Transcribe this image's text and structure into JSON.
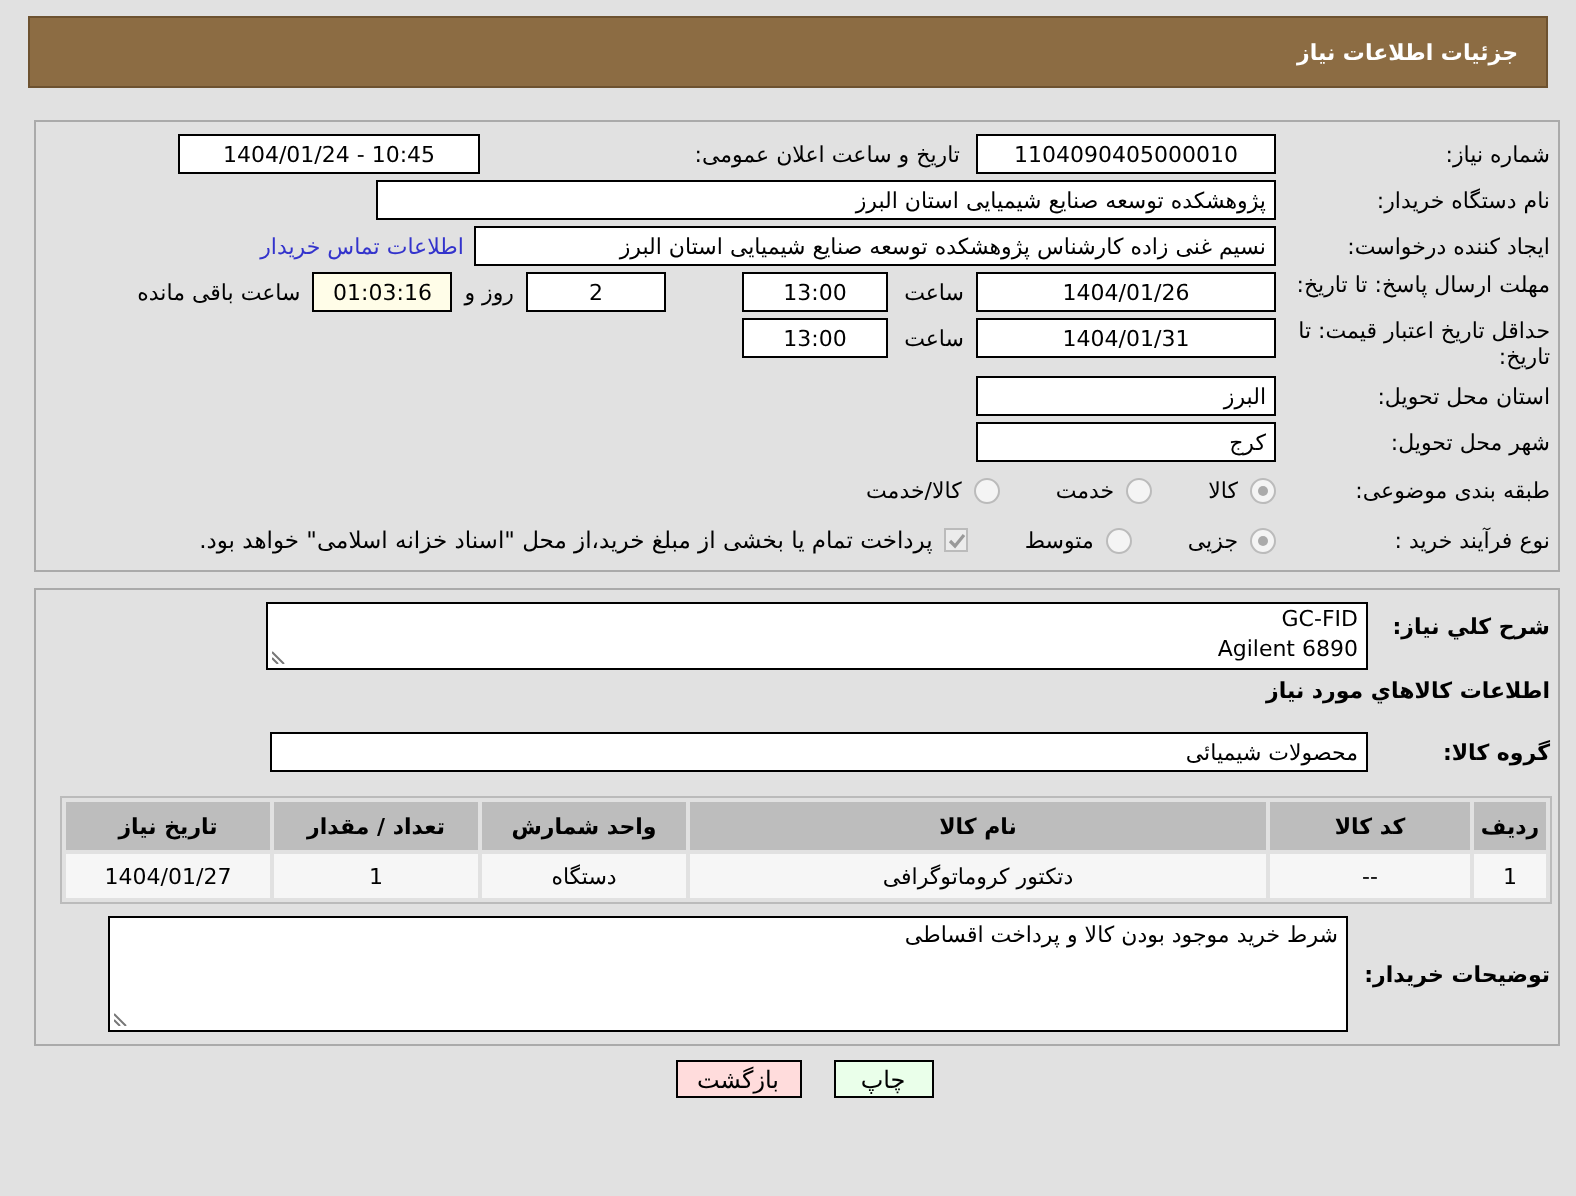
{
  "header": {
    "title": "جزئیات اطلاعات نیاز"
  },
  "need_number": {
    "label": "شماره نیاز:",
    "value": "1104090405000010"
  },
  "announce": {
    "label": "تاریخ و ساعت اعلان عمومی:",
    "value": "1404/01/24 - 10:45"
  },
  "buyer_org": {
    "label": "نام دستگاه خریدار:",
    "value": "پژوهشکده توسعه صنایع شیمیایی استان البرز"
  },
  "requester": {
    "label": "ایجاد کننده درخواست:",
    "value": "نسیم غنی زاده کارشناس پژوهشکده توسعه صنایع شیمیایی استان البرز",
    "link": "اطلاعات تماس خریدار"
  },
  "reply_deadline": {
    "label": "مهلت ارسال پاسخ: تا تاریخ:",
    "date": "1404/01/26",
    "time_label": "ساعت",
    "time": "13:00",
    "days": "2",
    "days_label": "روز و",
    "remaining": "01:03:16",
    "remaining_label": "ساعت باقی مانده"
  },
  "price_validity": {
    "label": "حداقل تاریخ اعتبار قیمت: تا تاریخ:",
    "date": "1404/01/31",
    "time_label": "ساعت",
    "time": "13:00"
  },
  "province": {
    "label": "استان محل تحویل:",
    "value": "البرز"
  },
  "city": {
    "label": "شهر محل تحویل:",
    "value": "کرج"
  },
  "category": {
    "label": "طبقه بندی موضوعی:",
    "options": [
      {
        "label": "کالا",
        "selected": true
      },
      {
        "label": "خدمت",
        "selected": false
      },
      {
        "label": "کالا/خدمت",
        "selected": false
      }
    ]
  },
  "process": {
    "label": "نوع فرآیند خرید :",
    "options": [
      {
        "label": "جزیی",
        "selected": true
      },
      {
        "label": "متوسط",
        "selected": false
      }
    ],
    "payment": {
      "label": "پرداخت تمام یا بخشی از مبلغ خرید،از محل \"اسناد خزانه اسلامی\" خواهد بود.",
      "checked": true
    }
  },
  "description": {
    "label": "شرح کلي نياز:",
    "lines": [
      "GC-FID",
      "Agilent 6890"
    ]
  },
  "goods_heading": "اطلاعات کالاهاي مورد نياز",
  "goods_group": {
    "label": "گروه کالا:",
    "value": "محصولات شیمیائی"
  },
  "table": {
    "columns": [
      "ردیف",
      "کد کالا",
      "نام کالا",
      "واحد شمارش",
      "تعداد / مقدار",
      "تاریخ نیاز"
    ],
    "rows": [
      [
        "1",
        "--",
        "دتکتور کروماتوگرافی",
        "دستگاه",
        "1",
        "1404/01/27"
      ]
    ]
  },
  "notes": {
    "label": "توضیحات خریدار:",
    "value": "شرط خرید موجود بودن کالا و پرداخت اقساطی"
  },
  "buttons": [
    {
      "label": "چاپ",
      "kind": "print"
    },
    {
      "label": "بازگشت",
      "kind": "back"
    }
  ]
}
